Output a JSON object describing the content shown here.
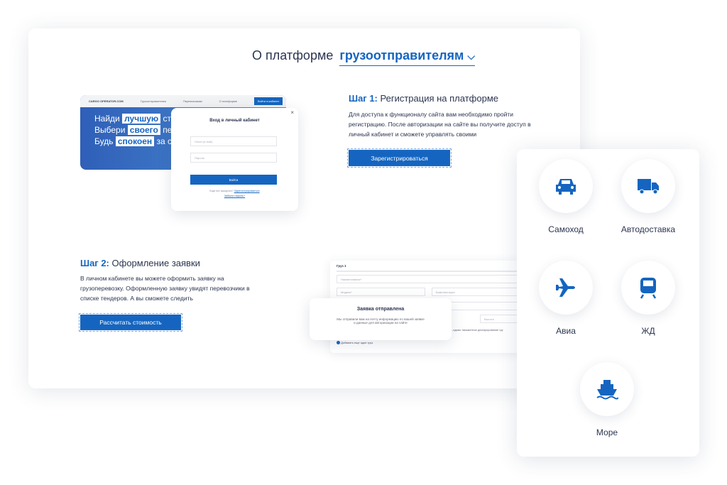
{
  "header": {
    "prefix": "О платформе",
    "audience": "грузоотправителям"
  },
  "step1": {
    "label": "Шаг 1:",
    "title": "Регистрация на платформе",
    "text": "Для доступа к функционалу сайта вам необходимо пройти регистрацию. После авторизации на сайте вы получите доступ в личный кабинет и сможете управлять своими",
    "button": "Зарегистрироваться"
  },
  "step2": {
    "label": "Шаг 2:",
    "title": "Оформление заявки",
    "text": "В личном кабинете вы можете оформить заявку на грузоперевозку. Оформленную заявку увидят перевозчики в списке тендеров. А вы сможете следить",
    "button": "Рассчитать стоимость"
  },
  "site": {
    "logo": "CARGO OPERATOR.COM",
    "nav": [
      "Грузоотправителям",
      "Перевозчикам",
      "О платформе"
    ],
    "login_btn": "Войти в кабинет",
    "hero": [
      {
        "a": "Найди",
        "k": "лучшую",
        "b": "ста"
      },
      {
        "a": "Выбери",
        "k": "своего",
        "b": "пер"
      },
      {
        "a": "Будь",
        "k": "спокоен",
        "b": "за св"
      }
    ]
  },
  "login": {
    "title": "Вход в личный кабинет",
    "login_ph": "Логин (e-mail)",
    "pass_ph": "Пароль",
    "submit": "Войти",
    "no_account": "Ещё нет аккаунта?",
    "register": "Зарегистрироваться",
    "forgot": "Забыли пароль?",
    "close": "×"
  },
  "order": {
    "cargo": "Груз 1",
    "name_ph": "Наименование*",
    "model_ph": "Модель*",
    "equip_ph": "Комплектация",
    "weight_ph": "...вки груза*",
    "height_ph": "Высота",
    "customs": "...одимо таможенное декларирование гру",
    "add": "Добавить еще один груз"
  },
  "sent": {
    "title": "Заявка отправлена",
    "text1": "Мы отправили вам на почту информацию по вашей заявке",
    "text2": "и данные для авторизации на сайте"
  },
  "transport": [
    {
      "label": "Самоход",
      "icon": "car-icon"
    },
    {
      "label": "Автодоставка",
      "icon": "truck-icon"
    },
    {
      "label": "Авиа",
      "icon": "plane-icon"
    },
    {
      "label": "ЖД",
      "icon": "train-icon"
    },
    {
      "label": "Море",
      "icon": "ship-icon"
    }
  ],
  "accent": "#1565c0"
}
